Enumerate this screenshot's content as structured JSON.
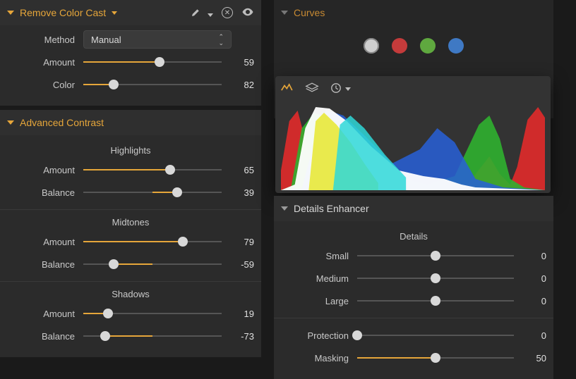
{
  "remove_color_cast": {
    "title": "Remove Color Cast",
    "method_label": "Method",
    "method_value": "Manual",
    "amount_label": "Amount",
    "amount_value": 59,
    "amount_pct": 55,
    "color_label": "Color",
    "color_value": 82,
    "color_pct": 22
  },
  "advanced_contrast": {
    "title": "Advanced Contrast",
    "highlights": {
      "heading": "Highlights",
      "amount_label": "Amount",
      "amount_value": 65,
      "amount_pct": 63,
      "balance_label": "Balance",
      "balance_value": 39,
      "balance_pct": 68,
      "balance_fill_from": 50
    },
    "midtones": {
      "heading": "Midtones",
      "amount_label": "Amount",
      "amount_value": 79,
      "amount_pct": 72,
      "balance_label": "Balance",
      "balance_value": -59,
      "balance_pct": 22,
      "balance_fill_from": 50
    },
    "shadows": {
      "heading": "Shadows",
      "amount_label": "Amount",
      "amount_value": 19,
      "amount_pct": 18,
      "balance_label": "Balance",
      "balance_value": -73,
      "balance_pct": 16,
      "balance_fill_from": 50
    }
  },
  "curves": {
    "title": "Curves"
  },
  "details_enhancer": {
    "title": "Details Enhancer",
    "details_heading": "Details",
    "small_label": "Small",
    "small_value": 0,
    "small_pct": 50,
    "medium_label": "Medium",
    "medium_value": 0,
    "medium_pct": 50,
    "large_label": "Large",
    "large_value": 0,
    "large_pct": 50,
    "protection_label": "Protection",
    "protection_value": 0,
    "protection_pct": 0,
    "masking_label": "Masking",
    "masking_value": 50,
    "masking_pct": 50
  }
}
